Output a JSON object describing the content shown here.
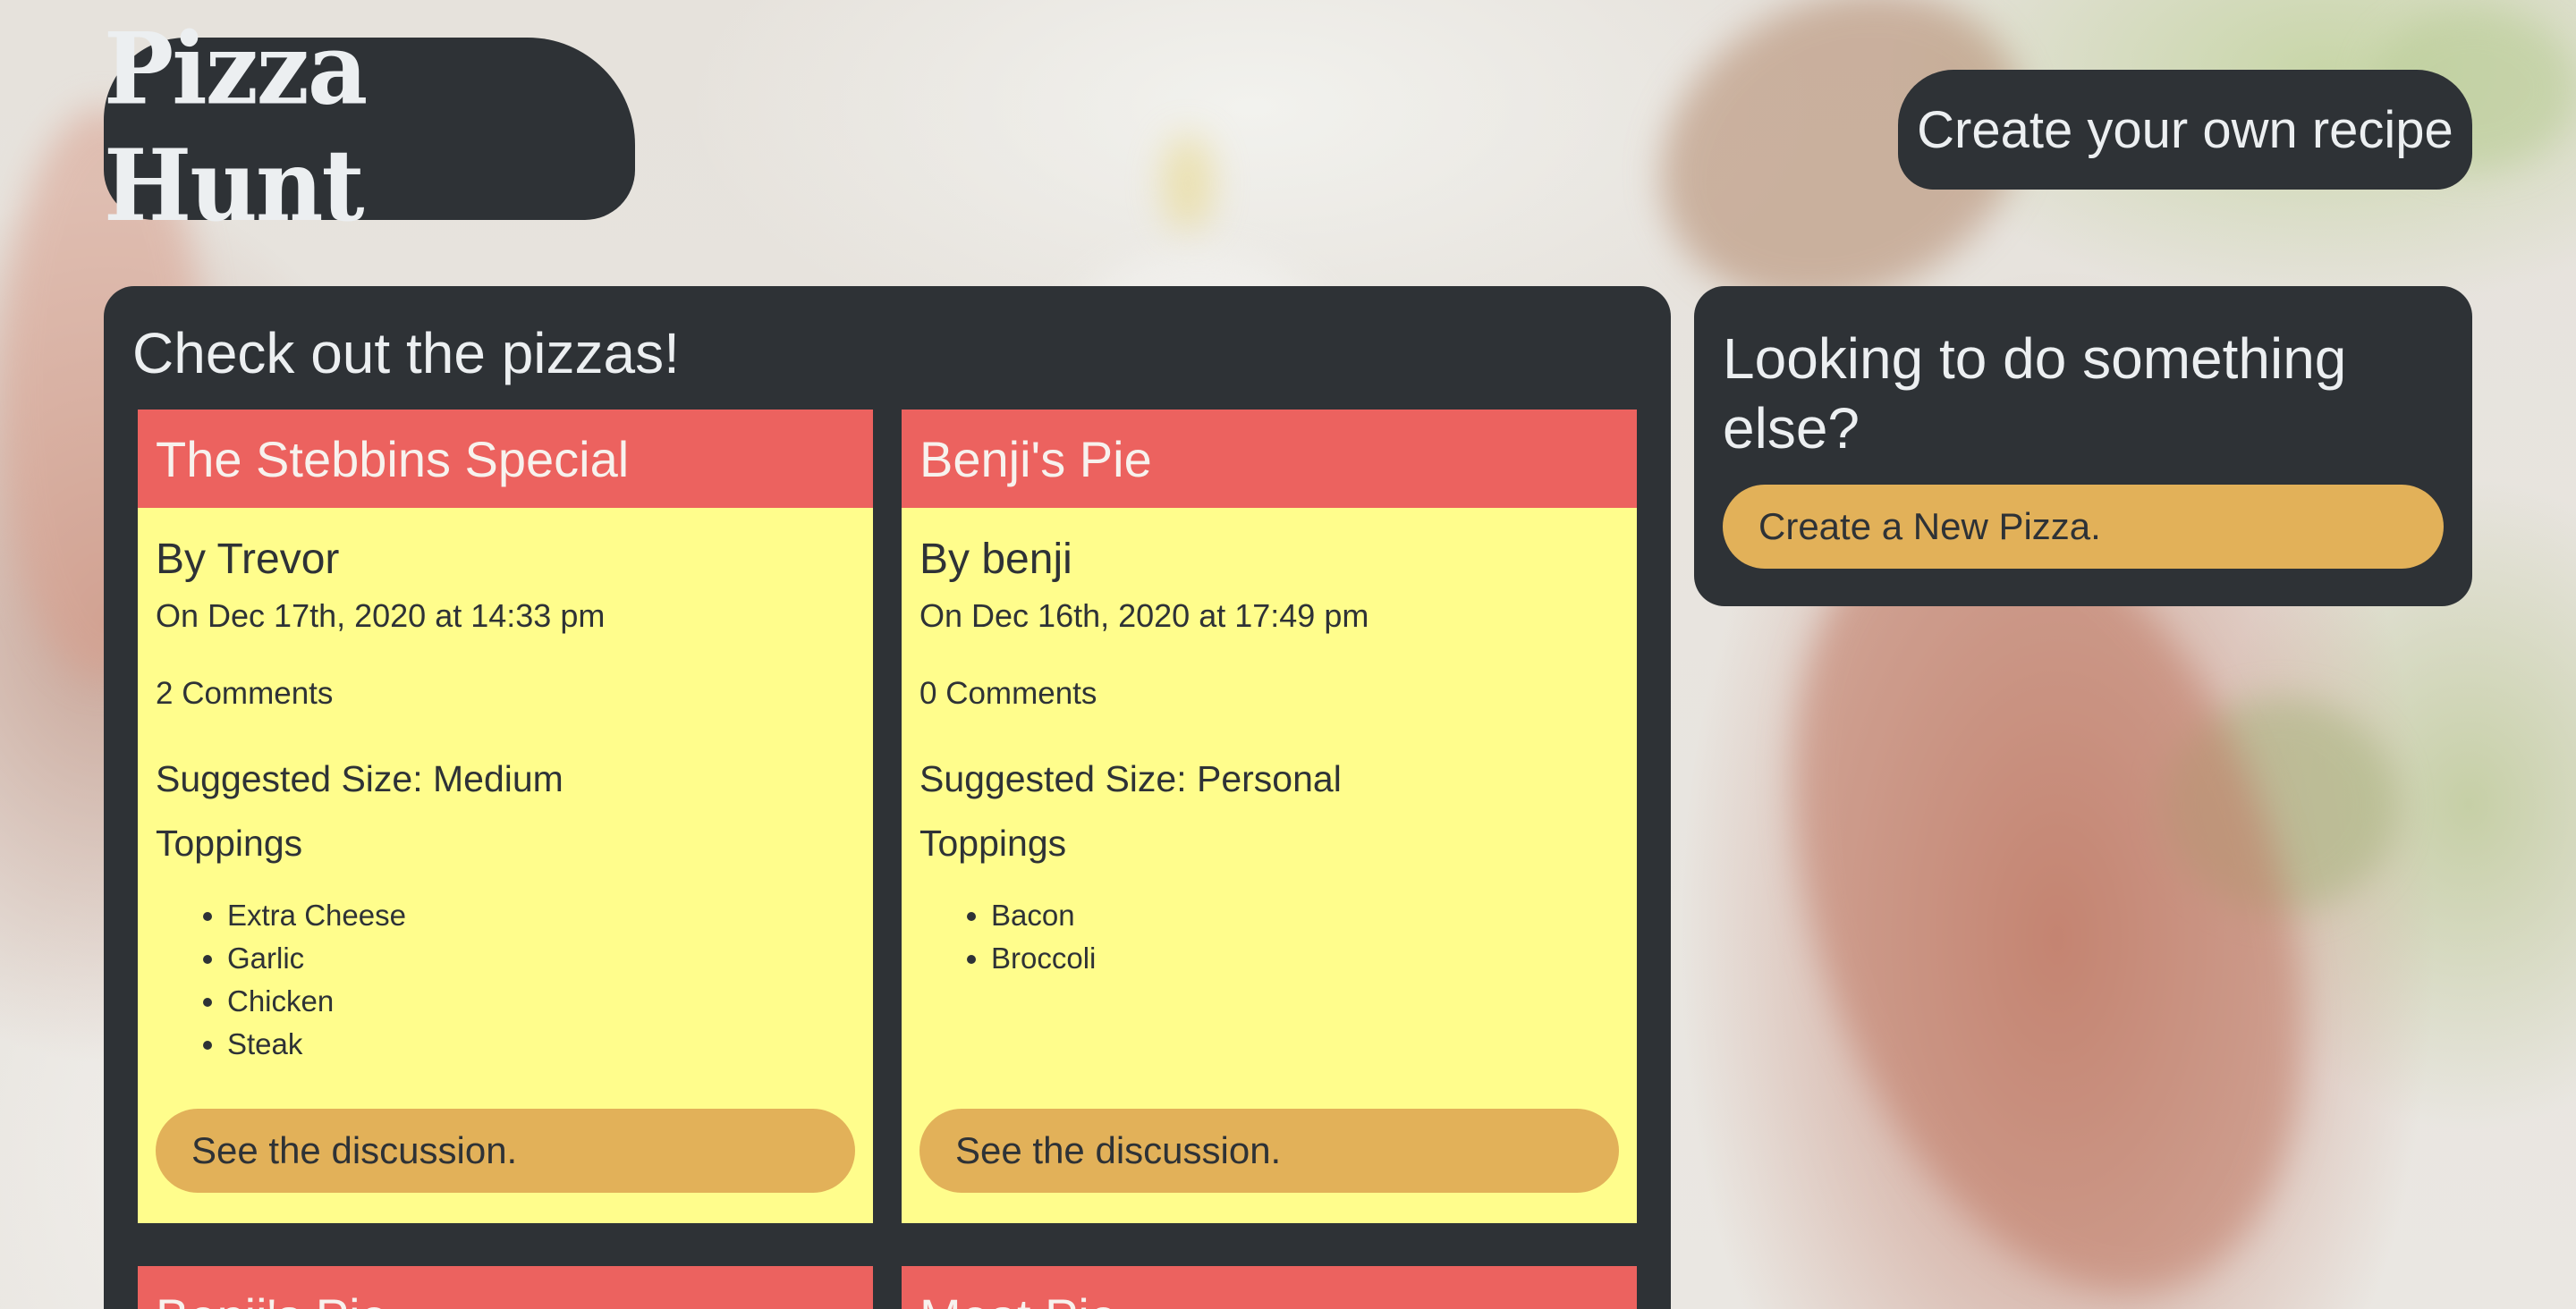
{
  "header": {
    "logo_text": "Pizza Hunt",
    "create_recipe_label": "Create your own recipe"
  },
  "main": {
    "title": "Check out the pizzas!",
    "pizzas": [
      {
        "name": "The Stebbins Special",
        "author": "By Trevor",
        "date": "On Dec 17th, 2020 at 14:33 pm",
        "comments": "2 Comments",
        "size": "Suggested Size: Medium",
        "toppings_label": "Toppings",
        "toppings": [
          "Extra Cheese",
          "Garlic",
          "Chicken",
          "Steak"
        ],
        "discussion_label": "See the discussion."
      },
      {
        "name": "Benji's Pie",
        "author": "By benji",
        "date": "On Dec 16th, 2020 at 17:49 pm",
        "comments": "0 Comments",
        "size": "Suggested Size: Personal",
        "toppings_label": "Toppings",
        "toppings": [
          "Bacon",
          "Broccoli"
        ],
        "discussion_label": "See the discussion."
      }
    ],
    "partial_pizzas": [
      "Benji's Pie",
      "Meat Pie"
    ]
  },
  "side": {
    "title": "Looking to do something else?",
    "new_pizza_label": "Create a New Pizza."
  },
  "colors": {
    "panel": "#2e3236",
    "card_header": "#ec625f",
    "card_body": "#fffd8c",
    "button": "#e2b159"
  }
}
